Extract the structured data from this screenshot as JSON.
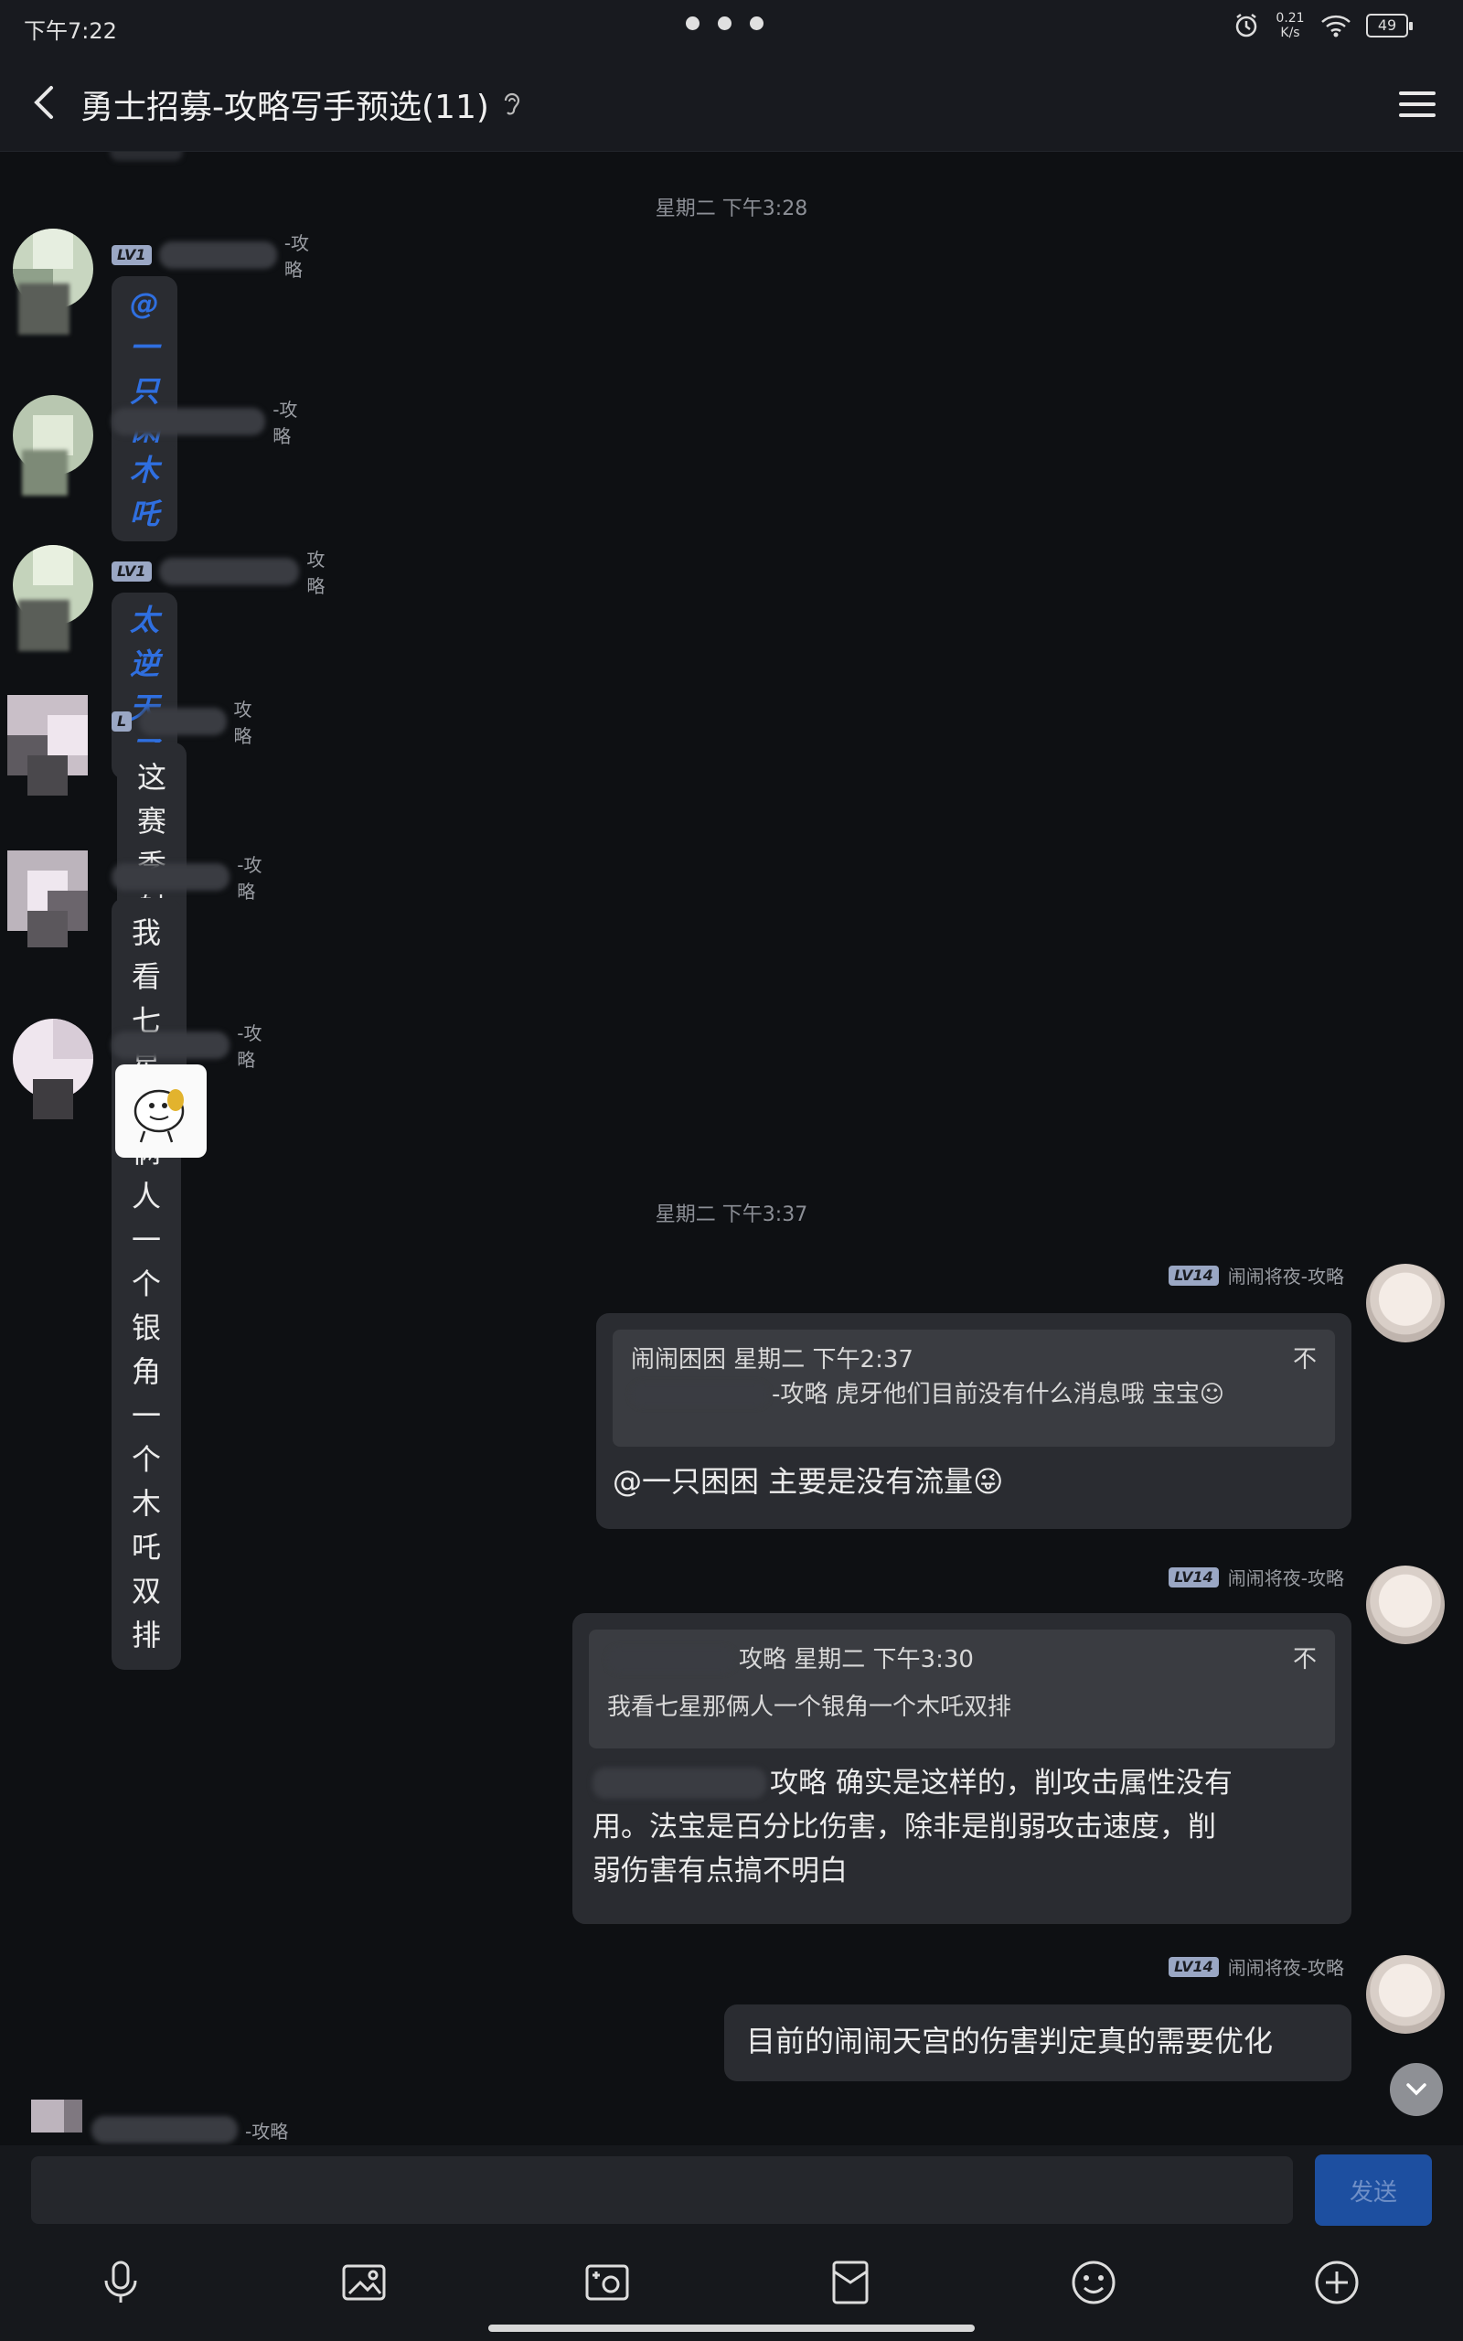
{
  "status_bar": {
    "time": "下午7:22",
    "net_speed_top": "0.21",
    "net_speed_bottom": "K/s",
    "battery": "49"
  },
  "header": {
    "title": "勇士招募-攻略写手预选(11)"
  },
  "timestamps": {
    "first": "星期二 下午3:28",
    "second": "星期二 下午3:37"
  },
  "incoming": [
    {
      "lv": "LV1",
      "suffix": "-攻略",
      "text": "@一只困困",
      "style": "blue"
    },
    {
      "lv": "",
      "suffix": "-攻略",
      "text": "木吒",
      "style": "blue"
    },
    {
      "lv": "LV1",
      "suffix": "攻略",
      "text": "太逆天了",
      "style": "blue"
    },
    {
      "lv": "L",
      "suffix": "攻略",
      "text": "这赛季射手太强了",
      "style": "normal"
    },
    {
      "lv": "",
      "suffix": "-攻略",
      "text": "我看七星那俩人一个银角一个木吒双排",
      "style": "normal"
    },
    {
      "lv": "",
      "suffix": "-攻略",
      "text": "",
      "style": "sticker"
    }
  ],
  "outgoing": [
    {
      "lv": "LV14",
      "sender": "闹闹将夜-攻略",
      "quote_header": "闹闹困困 星期二 下午2:37",
      "quote_text": "-攻略 虎牙他们目前没有什么消息哦 宝宝☺",
      "text": "@一只困困 主要是没有流量😜"
    },
    {
      "lv": "LV14",
      "sender": "闹闹将夜-攻略",
      "quote_header": "攻略 星期二 下午3:30",
      "quote_text": "我看七星那俩人一个银角一个木吒双排",
      "text_lines": [
        "攻略 确实是这样的，削攻击属性没有",
        "用。法宝是百分比伤害，除非是削弱攻击速度，削",
        "弱伤害有点搞不明白"
      ]
    },
    {
      "lv": "LV14",
      "sender": "闹闹将夜-攻略",
      "text": "目前的闹闹天宫的伤害判定真的需要优化"
    }
  ],
  "last_incoming": {
    "suffix": "-攻略"
  },
  "input": {
    "send_label": "发送"
  },
  "icons": {
    "back": "back-arrow-icon",
    "menu": "hamburger-menu-icon",
    "mic": "microphone-icon",
    "image": "image-icon",
    "camera": "camera-icon",
    "redpacket": "red-packet-icon",
    "emoji": "emoji-icon",
    "plus": "plus-circle-icon"
  }
}
